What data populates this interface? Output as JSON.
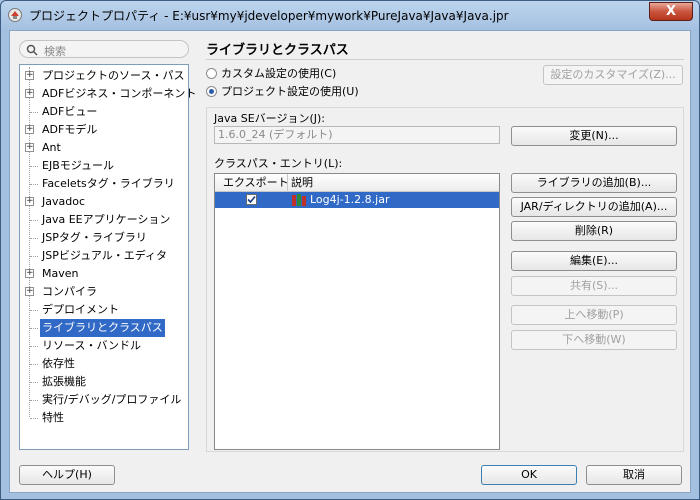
{
  "window": {
    "title": "プロジェクトプロパティ - E:¥usr¥my¥jdeveloper¥mywork¥PureJava¥Java¥Java.jpr",
    "close_label": "X"
  },
  "search": {
    "placeholder": "検索"
  },
  "tree": {
    "items": [
      {
        "label": "プロジェクトのソース・パス",
        "expandable": true
      },
      {
        "label": "ADFビジネス・コンポーネント",
        "expandable": true
      },
      {
        "label": "ADFビュー",
        "expandable": false
      },
      {
        "label": "ADFモデル",
        "expandable": true
      },
      {
        "label": "Ant",
        "expandable": true
      },
      {
        "label": "EJBモジュール",
        "expandable": false
      },
      {
        "label": "Faceletsタグ・ライブラリ",
        "expandable": false
      },
      {
        "label": "Javadoc",
        "expandable": true
      },
      {
        "label": "Java EEアプリケーション",
        "expandable": false
      },
      {
        "label": "JSPタグ・ライブラリ",
        "expandable": false
      },
      {
        "label": "JSPビジュアル・エディタ",
        "expandable": false
      },
      {
        "label": "Maven",
        "expandable": true
      },
      {
        "label": "コンパイラ",
        "expandable": true
      },
      {
        "label": "デプロイメント",
        "expandable": false
      },
      {
        "label": "ライブラリとクラスパス",
        "expandable": false,
        "selected": true
      },
      {
        "label": "リソース・バンドル",
        "expandable": false
      },
      {
        "label": "依存性",
        "expandable": false
      },
      {
        "label": "拡張機能",
        "expandable": false
      },
      {
        "label": "実行/デバッグ/プロファイル",
        "expandable": false
      },
      {
        "label": "特性",
        "expandable": false
      }
    ]
  },
  "panel": {
    "title": "ライブラリとクラスパス",
    "radio_custom": "カスタム設定の使用(C)",
    "radio_project": "プロジェクト設定の使用(U)",
    "customize_button": "設定のカスタマイズ(Z)...",
    "java_se_label": "Java SEバージョン(J):",
    "java_se_value": "1.6.0_24 (デフォルト)",
    "change_button": "変更(N)...",
    "classpath_label": "クラスパス・エントリ(L):",
    "columns": {
      "export": "エクスポート",
      "description": "説明"
    },
    "rows": [
      {
        "export": true,
        "description": "Log4j-1.2.8.jar"
      }
    ],
    "buttons": {
      "add_library": "ライブラリの追加(B)...",
      "add_jar": "JAR/ディレクトリの追加(A)...",
      "remove": "削除(R)",
      "edit": "編集(E)...",
      "share": "共有(S)...",
      "move_up": "上へ移動(P)",
      "move_down": "下へ移動(W)"
    }
  },
  "footer": {
    "help": "ヘルプ(H)",
    "ok": "OK",
    "cancel": "取消"
  },
  "colors": {
    "selection": "#3169c6",
    "title_bar": "#a4c0e0",
    "close_button": "#c9553f"
  }
}
